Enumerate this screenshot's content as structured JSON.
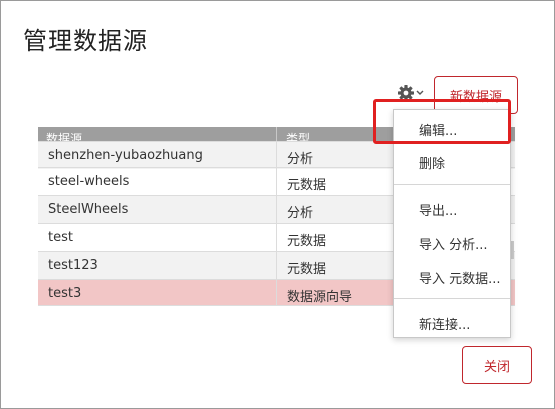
{
  "dialog": {
    "title": "管理数据源"
  },
  "toolbar": {
    "gear_icon": "gear-icon",
    "new_datasource_label": "新数据源"
  },
  "table": {
    "headers": [
      "数据源",
      "类型"
    ],
    "rows": [
      {
        "name": "shenzhen-yubaozhuang",
        "type": "分析"
      },
      {
        "name": "steel-wheels",
        "type": "元数据"
      },
      {
        "name": "SteelWheels",
        "type": "分析"
      },
      {
        "name": "test",
        "type": "元数据"
      },
      {
        "name": "test123",
        "type": "元数据"
      },
      {
        "name": "test3",
        "type": "数据源向导"
      }
    ],
    "selected_row": 5
  },
  "menu": {
    "items": [
      "编辑...",
      "删除",
      "导出...",
      "导入 分析...",
      "导入 元数据...",
      "新连接..."
    ]
  },
  "footer": {
    "close_label": "关闭"
  },
  "colors": {
    "accent": "#c0272d",
    "selected_row": "#f2c6c6",
    "header_bg": "#9e9e9e",
    "highlight": "#e02020"
  }
}
